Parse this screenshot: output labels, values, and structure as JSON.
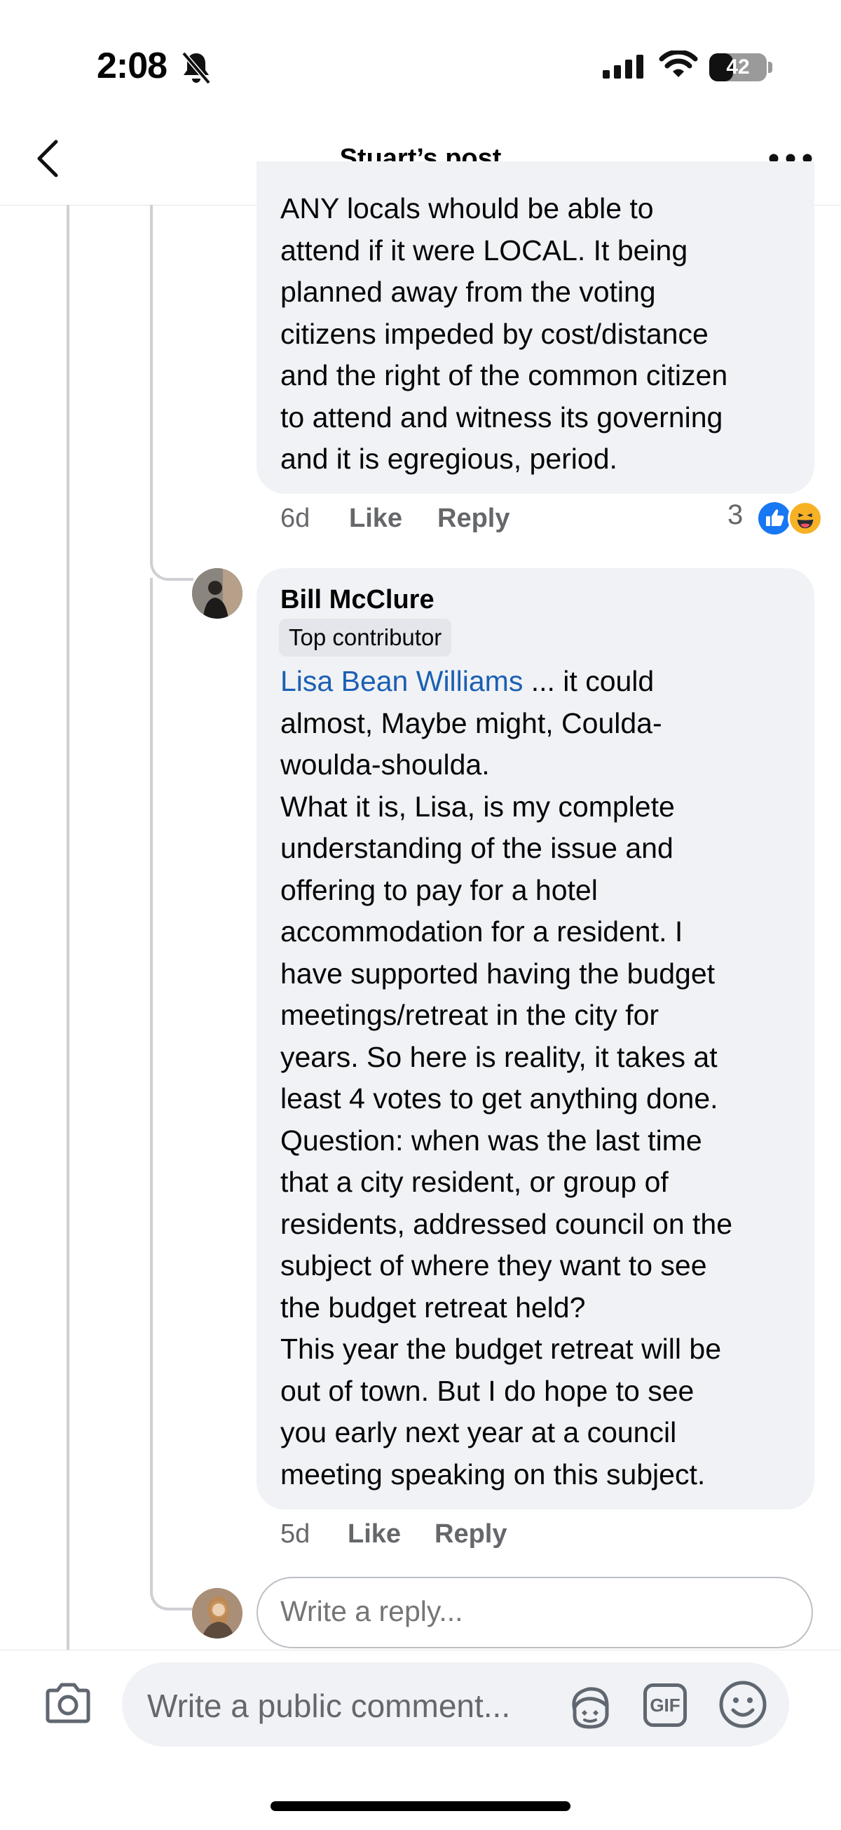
{
  "status_bar": {
    "time": "2:08",
    "battery": "42",
    "battery_fraction": 0.42
  },
  "header": {
    "title": "Stuart’s post"
  },
  "comments": [
    {
      "lines": [
        "ANY locals whould be able to",
        "attend if it were LOCAL. It being",
        "planned away from the voting",
        "citizens impeded by cost/distance",
        "and the right of the common citizen",
        "to attend and witness its governing",
        "and it is egregious, period."
      ],
      "time": "6d",
      "like_label": "Like",
      "reply_label": "Reply",
      "reaction_count": "3",
      "reactions": [
        "like-icon",
        "haha-icon"
      ]
    },
    {
      "author": "Bill McClure",
      "badge": "Top contributor",
      "mention": "Lisa Bean Williams",
      "first_line_rest": " ... it could",
      "lines": [
        "almost, Maybe might, Coulda-",
        "woulda-shoulda.",
        "What it is, Lisa, is my complete",
        "understanding of the issue and",
        "offering to pay for a hotel",
        "accommodation for a resident. I",
        "have supported having the budget",
        "meetings/retreat in the city for",
        "years. So here is reality, it takes at",
        "least 4 votes to get anything done.",
        "Question: when was the last time",
        "that a city resident, or group of",
        "residents, addressed council on the",
        "subject of where they want to see",
        "the budget retreat held?",
        "This year the budget retreat will be",
        "out of town. But I do hope to see",
        "you early next year at a council",
        "meeting speaking on this subject."
      ],
      "time": "5d",
      "like_label": "Like",
      "reply_label": "Reply"
    }
  ],
  "reply_box": {
    "placeholder": "Write a reply..."
  },
  "composer": {
    "placeholder": "Write a public comment...",
    "gif_label": "GIF"
  },
  "colors": {
    "accent": "#1877f2",
    "mention": "#1b5fb3",
    "bubble": "#f0f2f5",
    "meta": "#65676b"
  }
}
